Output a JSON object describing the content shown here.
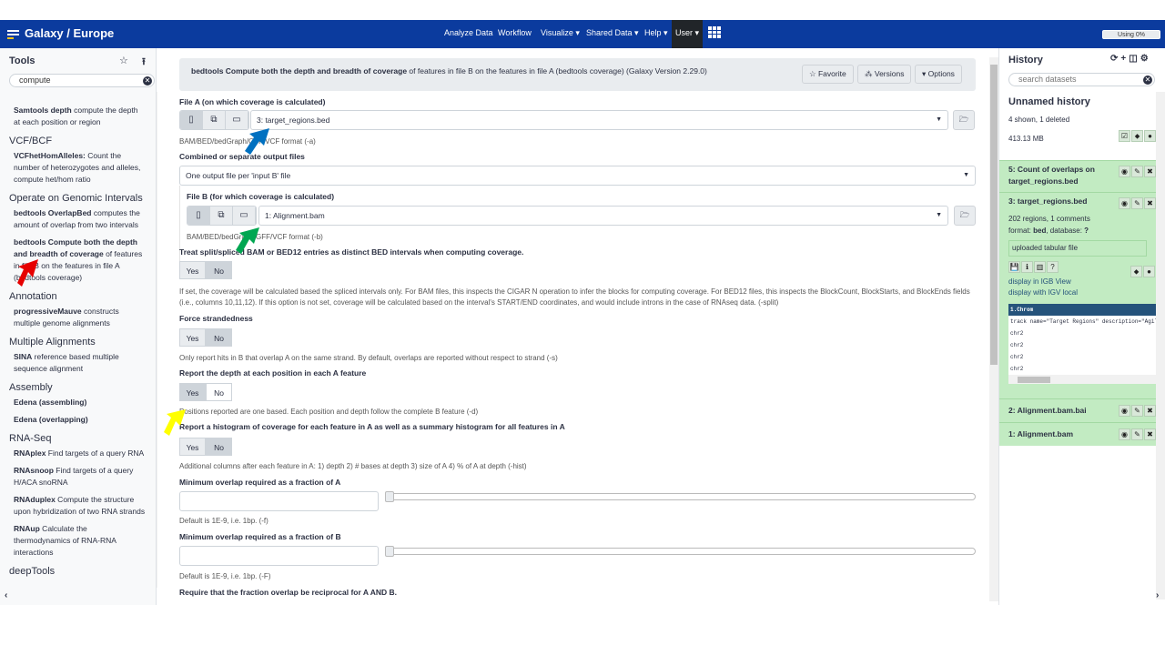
{
  "navbar": {
    "brand": "Galaxy / Europe",
    "items": [
      "Analyze Data",
      "Workflow",
      "Visualize ▾",
      "Shared Data ▾",
      "Help ▾"
    ],
    "user": "User ▾",
    "quota": "Using 0%"
  },
  "tools": {
    "title": "Tools",
    "search": "compute",
    "sections": [
      {
        "tools": [
          {
            "name": "Samtools depth",
            "desc": " compute the depth at each position or region"
          }
        ]
      },
      {
        "name": "VCF/BCF",
        "tools": [
          {
            "name": "VCFhetHomAlleles:",
            "desc": " Count the number of heterozygotes and alleles, compute het/hom ratio"
          }
        ]
      },
      {
        "name": "Operate on Genomic Intervals",
        "tools": [
          {
            "name": "bedtools OverlapBed",
            "desc": " computes the amount of overlap from two intervals"
          },
          {
            "name": "bedtools Compute both the depth and breadth of coverage",
            "desc": " of features in file B on the features in file A (bedtools coverage)"
          }
        ]
      },
      {
        "name": "Annotation",
        "tools": [
          {
            "name": "progressiveMauve",
            "desc": " constructs multiple genome alignments"
          }
        ]
      },
      {
        "name": "Multiple Alignments",
        "tools": [
          {
            "name": "SINA",
            "desc": " reference based multiple sequence alignment"
          }
        ]
      },
      {
        "name": "Assembly",
        "tools": [
          {
            "name": "Edena (assembling)",
            "desc": ""
          },
          {
            "name": "Edena (overlapping)",
            "desc": ""
          }
        ]
      },
      {
        "name": "RNA-Seq",
        "tools": [
          {
            "name": "RNAplex",
            "desc": " Find targets of a query RNA"
          },
          {
            "name": "RNAsnoop",
            "desc": " Find targets of a query H/ACA snoRNA"
          },
          {
            "name": "RNAduplex",
            "desc": " Compute the structure upon hybridization of two RNA strands"
          },
          {
            "name": "RNAup",
            "desc": " Calculate the thermodynamics of RNA-RNA interactions"
          }
        ]
      },
      {
        "name": "deepTools",
        "tools": []
      }
    ]
  },
  "form": {
    "title_bold": "bedtools Compute both the depth and breadth of coverage",
    "title_rest": " of features in file B on the features in file A (bedtools coverage) (Galaxy Version 2.29.0)",
    "favorite": "☆ Favorite",
    "versions": "Versions",
    "options": "▾ Options",
    "fileA": {
      "label": "File A (on which coverage is calculated)",
      "value": "3: target_regions.bed",
      "help": "BAM/BED/bedGraph/GFF/VCF format (-a)"
    },
    "combined": {
      "label": "Combined or separate output files",
      "value": "One output file per 'input B' file"
    },
    "fileB": {
      "label": "File B (for which coverage is calculated)",
      "value": "1: Alignment.bam",
      "help": "BAM/BED/bedGraph/GFF/VCF format (-b)"
    },
    "split": {
      "label": "Treat split/spliced BAM or BED12 entries as distinct BED intervals when computing coverage.",
      "help": "If set, the coverage will be calculated based the spliced intervals only. For BAM files, this inspects the CIGAR N operation to infer the blocks for computing coverage. For BED12 files, this inspects the BlockCount, BlockStarts, and BlockEnds fields (i.e., columns 10,11,12). If this option is not set, coverage will be calculated based on the interval's START/END coordinates, and would include introns in the case of RNAseq data. (-split)",
      "selected": "No"
    },
    "strand": {
      "label": "Force strandedness",
      "help": "Only report hits in B that overlap A on the same strand. By default, overlaps are reported without respect to strand (-s)",
      "selected": "No"
    },
    "depth": {
      "label": "Report the depth at each position in each A feature",
      "help": "Positions reported are one based. Each position and depth follow the complete B feature (-d)",
      "selected": "Yes"
    },
    "hist": {
      "label": "Report a histogram of coverage for each feature in A as well as a summary histogram for all features in A",
      "help": "Additional columns after each feature in A: 1) depth 2) # bases at depth 3) size of A 4) % of A at depth (-hist)",
      "selected": "No"
    },
    "minA": {
      "label": "Minimum overlap required as a fraction of A",
      "value": "",
      "help": "Default is 1E-9, i.e. 1bp. (-f)"
    },
    "minB": {
      "label": "Minimum overlap required as a fraction of B",
      "value": "",
      "help": "Default is 1E-9, i.e. 1bp. (-F)"
    },
    "recip": {
      "label": "Require that the fraction overlap be reciprocal for A AND B."
    },
    "yes": "Yes",
    "no": "No"
  },
  "history": {
    "title": "History",
    "search_placeholder": "search datasets",
    "name": "Unnamed history",
    "shown": "4 shown, 1 deleted",
    "size": "413.13 MB",
    "datasets": [
      {
        "title": "5: Count of overlaps on target_regions.bed"
      },
      {
        "title": "3: target_regions.bed",
        "info": "202 regions, 1 comments",
        "format_label": "format: ",
        "format": "bed",
        "db_label": ", database: ",
        "db": "?",
        "annotation": "uploaded tabular file",
        "links": [
          "display in IGB View",
          "display with IGV local"
        ],
        "peek_header": "1.Chrom",
        "peek": [
          "track name=\"Target Regions\" description=\"Agile",
          "chr2",
          "chr2",
          "chr2",
          "chr2"
        ]
      },
      {
        "title": "2: Alignment.bam.bai"
      },
      {
        "title": "1: Alignment.bam"
      }
    ]
  },
  "colors": {
    "navbar": "#0b3b9e",
    "dataset_ok": "#c2ebc2",
    "peek_header": "#25537b"
  }
}
